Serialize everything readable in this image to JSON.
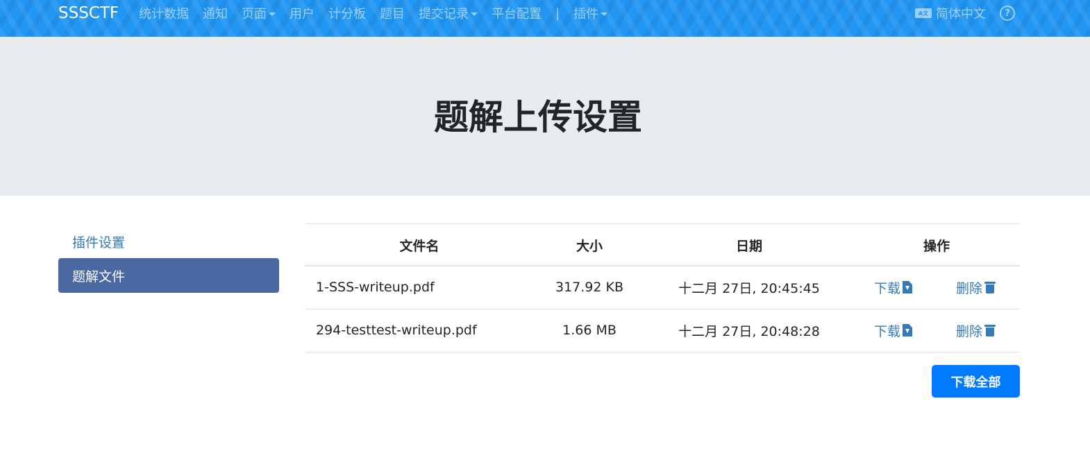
{
  "navbar": {
    "brand": "SSSCTF",
    "links": [
      "统计数据",
      "通知",
      "页面",
      "用户",
      "计分板",
      "题目",
      "提交记录",
      "平台配置"
    ],
    "separator": "|",
    "plugins": "插件",
    "language": "简体中文",
    "help_icon": "question-circle-icon",
    "lang_icon": "translate-icon",
    "accent": "#2196f3"
  },
  "jumbotron": {
    "title": "题解上传设置"
  },
  "sidebar": {
    "items": [
      "插件设置",
      "题解文件"
    ],
    "active": "题解文件",
    "active_color": "#4a68a2"
  },
  "table": {
    "headers": [
      "文件名",
      "大小",
      "日期",
      "操作"
    ],
    "rows": [
      {
        "name": "1-SSS-writeup.pdf",
        "size": "317.92 KB",
        "date": "十二月 27日, 20:45:45",
        "download": "下载",
        "delete": "删除"
      },
      {
        "name": "294-testtest-writeup.pdf",
        "size": "1.66 MB",
        "date": "十二月 27日, 20:48:28",
        "download": "下载",
        "delete": "删除"
      }
    ]
  },
  "download_all": "下载全部"
}
